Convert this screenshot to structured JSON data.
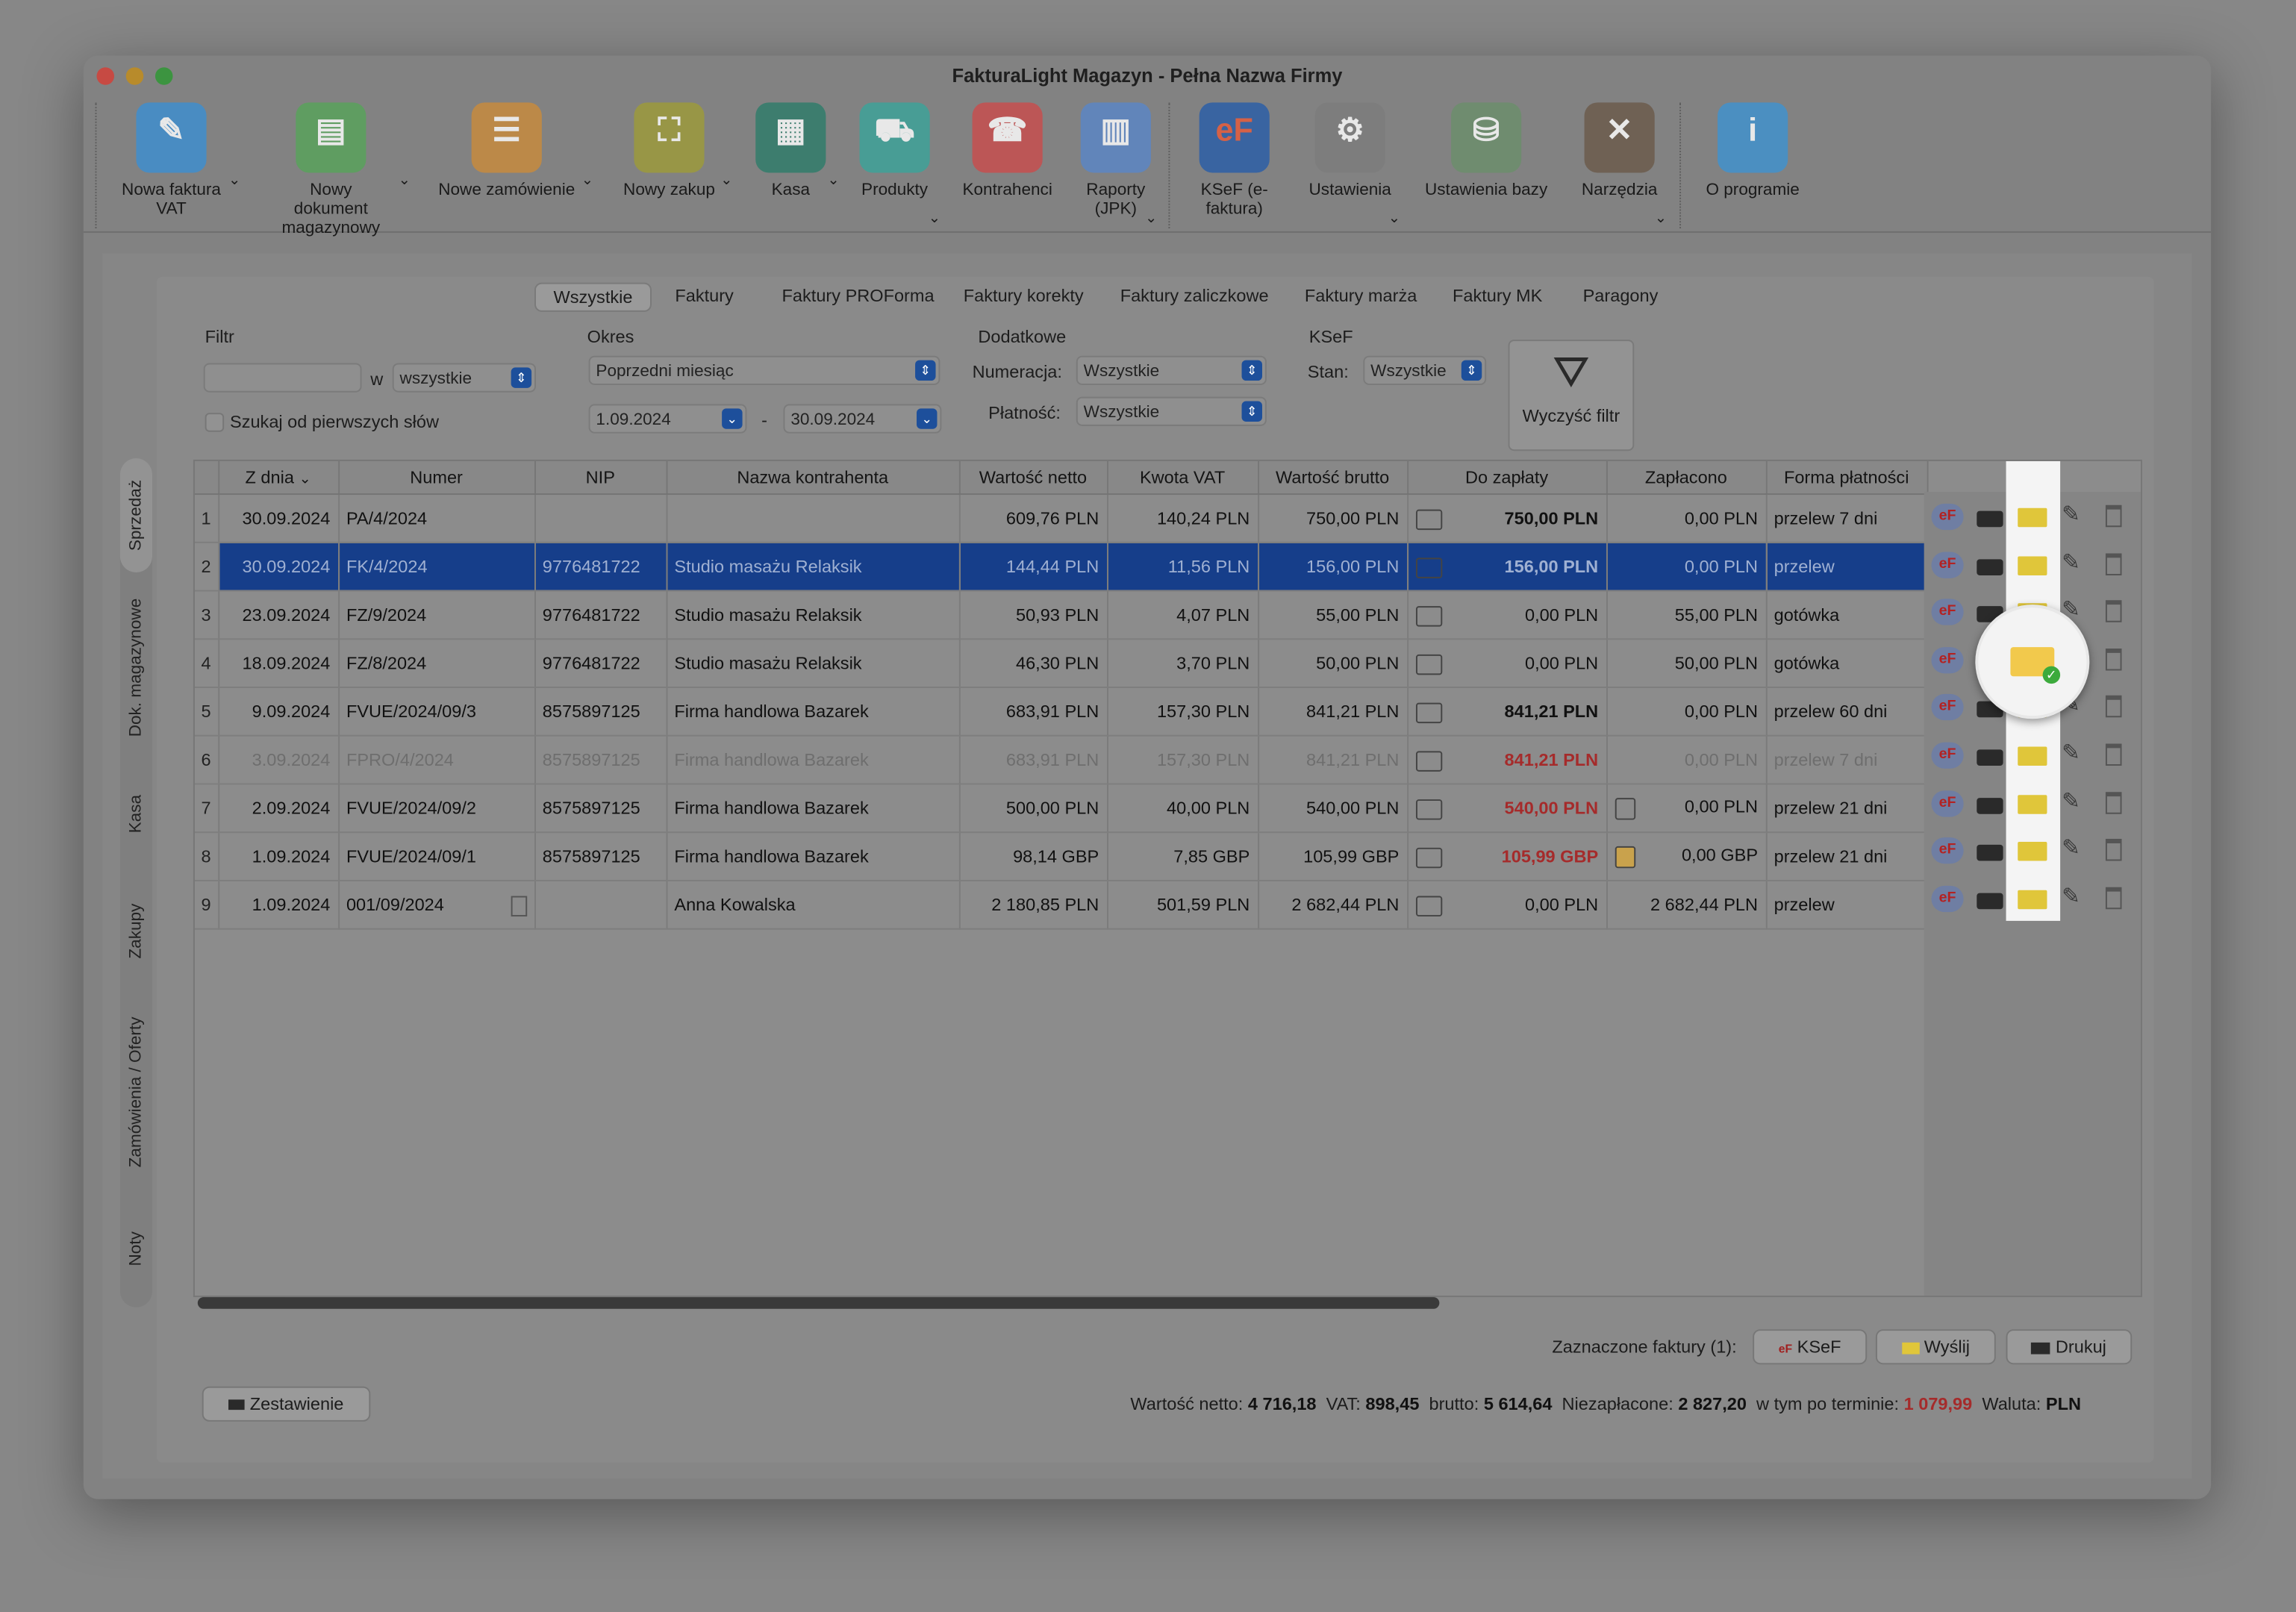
{
  "window": {
    "title": "FakturaLight Magazyn - Pełna Nazwa Firmy"
  },
  "toolbar": [
    {
      "label": "Nowa faktura VAT",
      "icon": "invoice-icon",
      "color": "#3d8fd1"
    },
    {
      "label": "Nowy dokument magazynowy",
      "icon": "warehouse-doc-icon",
      "color": "#58a35a"
    },
    {
      "label": "Nowe zamówienie",
      "icon": "order-icon",
      "color": "#c98b3c"
    },
    {
      "label": "Nowy zakup",
      "icon": "basket-icon",
      "color": "#9e9b3a"
    },
    {
      "label": "Kasa",
      "icon": "cash-register-icon",
      "color": "#2f7d6a"
    },
    {
      "label": "Produkty",
      "icon": "products-icon",
      "color": "#3ca39a"
    },
    {
      "label": "Kontrahenci",
      "icon": "contacts-icon",
      "color": "#c94d4d"
    },
    {
      "label": "Raporty (JPK)",
      "icon": "reports-icon",
      "color": "#5a86c7"
    },
    {
      "label": "KSeF (e-faktura)",
      "icon": "ksef-icon",
      "color": "#2a5ea9"
    },
    {
      "label": "Ustawienia",
      "icon": "settings-icon",
      "color": "#7d7d7d"
    },
    {
      "label": "Ustawienia bazy",
      "icon": "database-settings-icon",
      "color": "#6b8f6b"
    },
    {
      "label": "Narzędzia",
      "icon": "tools-icon",
      "color": "#6b5a4a"
    },
    {
      "label": "O programie",
      "icon": "info-icon",
      "color": "#3f93cf"
    }
  ],
  "tabs": [
    "Wszystkie",
    "Faktury",
    "Faktury PROForma",
    "Faktury korekty",
    "Faktury zaliczkowe",
    "Faktury marża",
    "Faktury MK",
    "Paragony"
  ],
  "active_tab": "Wszystkie",
  "side_tabs": [
    "Sprzedaż",
    "Dok. magazynowe",
    "Kasa",
    "Zakupy",
    "Zamówienia / Oferty",
    "Noty"
  ],
  "filters": {
    "filtr_label": "Filtr",
    "filtr_value": "",
    "w_label": "w",
    "w_value": "wszystkie",
    "search_first_words": "Szukaj od pierwszych słów",
    "okres_label": "Okres",
    "okres_value": "Poprzedni miesiąc",
    "date_from": "1.09.2024",
    "date_sep": "-",
    "date_to": "30.09.2024",
    "dodatkowe_label": "Dodatkowe",
    "numeracja_label": "Numeracja:",
    "numeracja_value": "Wszystkie",
    "platnosc_label": "Płatność:",
    "platnosc_value": "Wszystkie",
    "ksef_label": "KSeF",
    "stan_label": "Stan:",
    "stan_value": "Wszystkie",
    "clear_label": "Wyczyść filtr"
  },
  "columns": [
    "Z dnia",
    "Numer",
    "NIP",
    "Nazwa kontrahenta",
    "Wartość netto",
    "Kwota VAT",
    "Wartość brutto",
    "Do zapłaty",
    "Zapłacono",
    "Forma płatności"
  ],
  "rows": [
    [
      "1",
      "30.09.2024",
      "PA/4/2024",
      "",
      "",
      "609,76 PLN",
      "140,24 PLN",
      "750,00 PLN",
      "750,00 PLN",
      "0,00 PLN",
      "przelew 7 dni"
    ],
    [
      "2",
      "30.09.2024",
      "FK/4/2024",
      "9776481722",
      "Studio masażu Relaksik",
      "144,44 PLN",
      "11,56 PLN",
      "156,00 PLN",
      "156,00 PLN",
      "0,00 PLN",
      "przelew"
    ],
    [
      "3",
      "23.09.2024",
      "FZ/9/2024",
      "9776481722",
      "Studio masażu Relaksik",
      "50,93 PLN",
      "4,07 PLN",
      "55,00 PLN",
      "0,00 PLN",
      "55,00 PLN",
      "gotówka"
    ],
    [
      "4",
      "18.09.2024",
      "FZ/8/2024",
      "9776481722",
      "Studio masażu Relaksik",
      "46,30 PLN",
      "3,70 PLN",
      "50,00 PLN",
      "0,00 PLN",
      "50,00 PLN",
      "gotówka"
    ],
    [
      "5",
      "9.09.2024",
      "FVUE/2024/09/3",
      "8575897125",
      "Firma handlowa Bazarek",
      "683,91 PLN",
      "157,30 PLN",
      "841,21 PLN",
      "841,21 PLN",
      "0,00 PLN",
      "przelew 60 dni"
    ],
    [
      "6",
      "3.09.2024",
      "FPRO/4/2024",
      "8575897125",
      "Firma handlowa Bazarek",
      "683,91 PLN",
      "157,30 PLN",
      "841,21 PLN",
      "841,21 PLN",
      "0,00 PLN",
      "przelew 7 dni"
    ],
    [
      "7",
      "2.09.2024",
      "FVUE/2024/09/2",
      "8575897125",
      "Firma handlowa Bazarek",
      "500,00 PLN",
      "40,00 PLN",
      "540,00 PLN",
      "540,00 PLN",
      "0,00 PLN",
      "przelew 21 dni"
    ],
    [
      "8",
      "1.09.2024",
      "FVUE/2024/09/1",
      "8575897125",
      "Firma handlowa Bazarek",
      "98,14 GBP",
      "7,85 GBP",
      "105,99 GBP",
      "105,99 GBP",
      "0,00 GBP",
      "przelew 21 dni"
    ],
    [
      "9",
      "1.09.2024",
      "001/09/2024",
      "",
      "Anna Kowalska",
      "2 180,85 PLN",
      "501,59 PLN",
      "2 682,44 PLN",
      "0,00 PLN",
      "2 682,44 PLN",
      "przelew"
    ]
  ],
  "row_action_ef": "eF",
  "bottom": {
    "selected_label": "Zaznaczone faktury (1):",
    "ksef_btn": "KSeF",
    "send_btn": "Wyślij",
    "print_btn": "Drukuj",
    "report_btn": "Zestawienie",
    "netto_label": "Wartość netto:",
    "netto_value": "4 716,18",
    "vat_label": "VAT:",
    "vat_value": "898,45",
    "brutto_label": "brutto:",
    "brutto_value": "5 614,64",
    "unpaid_label": "Niezapłacone:",
    "unpaid_value": "2 827,20",
    "overdue_label": "w tym po terminie:",
    "overdue_value": "1 079,99",
    "currency_label": "Waluta:",
    "currency_value": "PLN"
  },
  "colors": {
    "selection": "#163e8a",
    "overdue": "#a52b2b",
    "envelope": "#e0c63a"
  }
}
